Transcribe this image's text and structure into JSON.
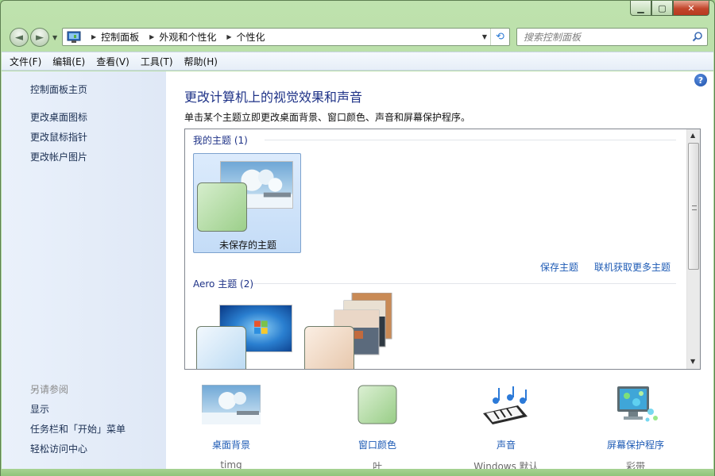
{
  "window": {
    "caption_buttons": {
      "minimize": "▁",
      "maximize": "▢",
      "close": "✕"
    }
  },
  "navigation": {
    "back_icon": "◄",
    "forward_icon": "►",
    "dropdown_icon": "▼"
  },
  "address_bar": {
    "root_icon": "control-panel-icon",
    "breadcrumbs": [
      "控制面板",
      "外观和个性化",
      "个性化"
    ],
    "separator": "▶",
    "dropdown": "▼",
    "refresh_icon": "⟲"
  },
  "search": {
    "placeholder": "搜索控制面板"
  },
  "menu": [
    "文件(F)",
    "编辑(E)",
    "查看(V)",
    "工具(T)",
    "帮助(H)"
  ],
  "left_pane": {
    "home": "控制面板主页",
    "links": [
      "更改桌面图标",
      "更改鼠标指针",
      "更改帐户图片"
    ],
    "see_also_title": "另请参阅",
    "see_also": [
      "显示",
      "任务栏和「开始」菜单",
      "轻松访问中心"
    ]
  },
  "main": {
    "help": "?",
    "title": "更改计算机上的视觉效果和声音",
    "description": "单击某个主题立即更改桌面背景、窗口颜色、声音和屏幕保护程序。",
    "groups": {
      "my_themes": {
        "title": "我的主题 (1)",
        "themes": [
          {
            "name": "未保存的主题",
            "selected": true
          }
        ],
        "links": [
          "保存主题",
          "联机获取更多主题"
        ]
      },
      "aero_themes": {
        "title": "Aero 主题 (2)"
      }
    },
    "settings": [
      {
        "label": "桌面背景",
        "value": "timg",
        "icon": "desktop-background-icon"
      },
      {
        "label": "窗口颜色",
        "value": "叶",
        "icon": "window-color-icon"
      },
      {
        "label": "声音",
        "value": "Windows 默认",
        "icon": "sound-icon"
      },
      {
        "label": "屏幕保护程序",
        "value": "彩带",
        "icon": "screensaver-icon"
      }
    ]
  },
  "colors": {
    "accent_link": "#1e5bb5",
    "title_blue": "#1e3287",
    "leaf_green": "#a9d89a",
    "frame_green": "#a7d694"
  }
}
